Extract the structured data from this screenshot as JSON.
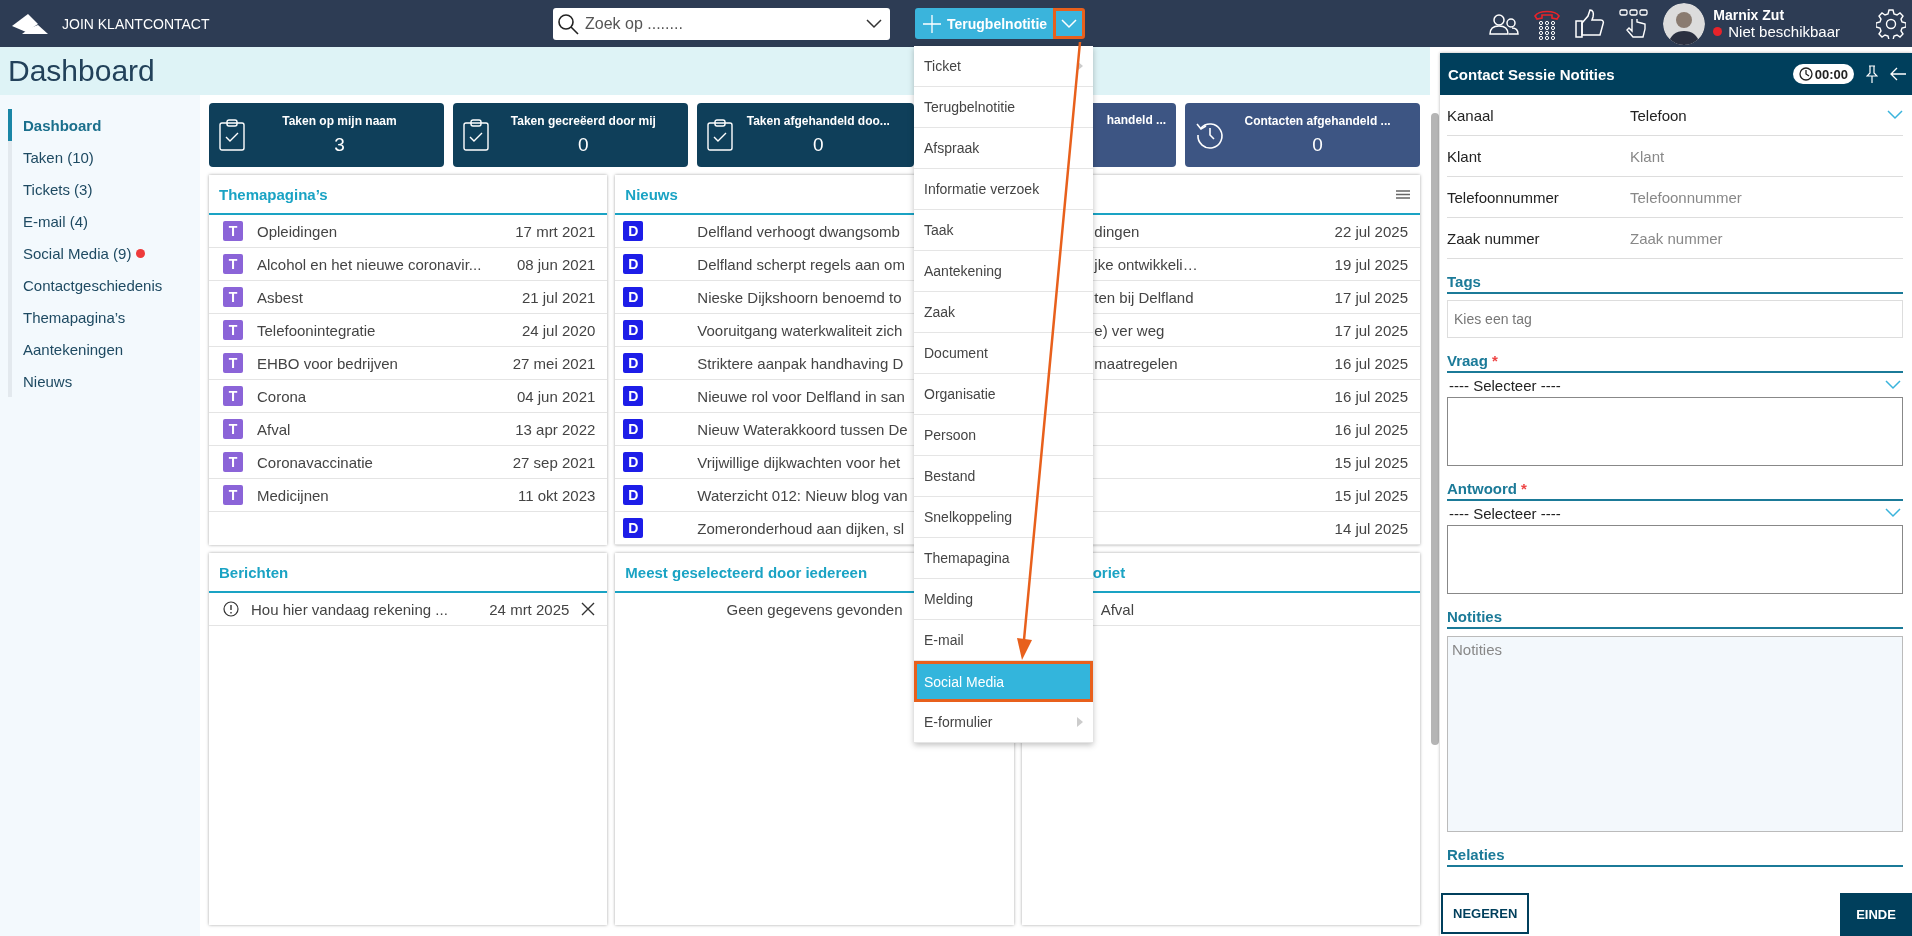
{
  "app": {
    "title": "JOIN KLANTCONTACT"
  },
  "search": {
    "placeholder": "Zoek op ........"
  },
  "new_button": {
    "label": "Terugbelnotitie",
    "expanded": true
  },
  "new_menu": [
    {
      "label": "Ticket",
      "submenu": true,
      "selected": false
    },
    {
      "label": "Terugbelnotitie",
      "submenu": false,
      "selected": false
    },
    {
      "label": "Afspraak",
      "submenu": false,
      "selected": false
    },
    {
      "label": "Informatie verzoek",
      "submenu": false,
      "selected": false
    },
    {
      "label": "Taak",
      "submenu": false,
      "selected": false
    },
    {
      "label": "Aantekening",
      "submenu": false,
      "selected": false
    },
    {
      "label": "Zaak",
      "submenu": false,
      "selected": false
    },
    {
      "label": "Document",
      "submenu": false,
      "selected": false
    },
    {
      "label": "Organisatie",
      "submenu": false,
      "selected": false
    },
    {
      "label": "Persoon",
      "submenu": false,
      "selected": false
    },
    {
      "label": "Bestand",
      "submenu": false,
      "selected": false
    },
    {
      "label": "Snelkoppeling",
      "submenu": false,
      "selected": false
    },
    {
      "label": "Themapagina",
      "submenu": false,
      "selected": false
    },
    {
      "label": "Melding",
      "submenu": false,
      "selected": false
    },
    {
      "label": "E-mail",
      "submenu": false,
      "selected": false
    },
    {
      "label": "Social Media",
      "submenu": false,
      "selected": true
    },
    {
      "label": "E-formulier",
      "submenu": true,
      "selected": false
    }
  ],
  "user": {
    "name": "Marnix Zut",
    "status": {
      "label": "Niet beschikbaar",
      "color": "#e8232a"
    }
  },
  "page_title": "Dashboard",
  "sidebar": [
    {
      "label": "Dashboard",
      "selected": true,
      "notification": false
    },
    {
      "label": "Taken (10)",
      "selected": false,
      "notification": false
    },
    {
      "label": "Tickets (3)",
      "selected": false,
      "notification": false
    },
    {
      "label": "E-mail (4)",
      "selected": false,
      "notification": false
    },
    {
      "label": "Social Media (9)",
      "selected": false,
      "notification": true
    },
    {
      "label": "Contactgeschiedenis",
      "selected": false,
      "notification": false
    },
    {
      "label": "Themapagina’s",
      "selected": false,
      "notification": false
    },
    {
      "label": "Aantekeningen",
      "selected": false,
      "notification": false
    },
    {
      "label": "Nieuws",
      "selected": false,
      "notification": false
    }
  ],
  "stat_cards": [
    {
      "kind": "task",
      "title": "Taken op mijn naam",
      "value": "3",
      "color": "#0f3f5a"
    },
    {
      "kind": "task",
      "title": "Taken gecreëerd door mij",
      "value": "0",
      "color": "#0f3f5a"
    },
    {
      "kind": "task",
      "title": "Taken afgehandeld doo...",
      "value": "0",
      "color": "#0f3f5a"
    },
    {
      "kind": "covered",
      "title": "handeld ...",
      "color": "#3d5583"
    },
    {
      "kind": "contact",
      "title": "Contacten afgehandeld ...",
      "value": "0",
      "color": "#3d5583"
    }
  ],
  "panels": [
    {
      "kind": "theme",
      "title": "Themapagina’s",
      "items": [
        {
          "badge": "T",
          "title": "Opleidingen",
          "date": "17 mrt 2021"
        },
        {
          "badge": "T",
          "title": "Alcohol en het nieuwe coronavir...",
          "date": "08 jun 2021"
        },
        {
          "badge": "T",
          "title": "Asbest",
          "date": "21 jul 2021"
        },
        {
          "badge": "T",
          "title": "Telefoonintegratie",
          "date": "24 jul 2020"
        },
        {
          "badge": "T",
          "title": "EHBO voor bedrijven",
          "date": "27 mei 2021"
        },
        {
          "badge": "T",
          "title": "Corona",
          "date": "04 jun 2021"
        },
        {
          "badge": "T",
          "title": "Afval",
          "date": "13 apr 2022"
        },
        {
          "badge": "T",
          "title": "Coronavaccinatie",
          "date": "27 sep 2021"
        },
        {
          "badge": "T",
          "title": "Medicijnen",
          "date": "11 okt 2023"
        }
      ]
    },
    {
      "kind": "news",
      "title": "Nieuws",
      "items": [
        {
          "badge": "D",
          "title": "Delfland verhoogt dwangsomb",
          "tail": "dingen",
          "date": "22 jul 2025"
        },
        {
          "badge": "D",
          "title": "Delfland scherpt regels aan om",
          "tail": "jke ontwikkeli…",
          "date": "19 jul 2025"
        },
        {
          "badge": "D",
          "title": "Nieske Dijkshoorn benoemd to",
          "tail": "ten bij Delfland",
          "date": "17 jul 2025"
        },
        {
          "badge": "D",
          "title": "Vooruitgang waterkwaliteit zich",
          "tail": "e) ver weg",
          "date": "17 jul 2025"
        },
        {
          "badge": "D",
          "title": "Striktere aanpak handhaving D",
          "tail": "maatregelen",
          "date": "16 jul 2025"
        },
        {
          "badge": "D",
          "title": "Nieuwe rol voor Delfland in san",
          "date": "16 jul 2025"
        },
        {
          "badge": "D",
          "title": "Nieuw Waterakkoord tussen De",
          "date": "16 jul 2025"
        },
        {
          "badge": "D",
          "title": "Vrijwillige dijkwachten voor het",
          "date": "15 jul 2025"
        },
        {
          "badge": "D",
          "title": "Waterzicht 012: Nieuw blog van",
          "date": "15 jul 2025"
        },
        {
          "badge": "D",
          "title": "Zomeronderhoud aan dijken, sl",
          "date": "14 jul 2025"
        }
      ]
    },
    {
      "kind": "messages",
      "title": "Berichten",
      "items": [
        {
          "title": "Hou hier vandaag rekening ...",
          "date": "24 mrt 2025"
        }
      ]
    },
    {
      "kind": "empty",
      "title": "Meest geselecteerd door iedereen",
      "empty_text": "Geen gegevens gevonden"
    },
    {
      "kind": "favorites",
      "title": "oriet",
      "items": [
        {
          "title": "Afval"
        }
      ]
    }
  ],
  "session": {
    "title": "Contact Sessie Notities",
    "timer": "00:00",
    "fields": [
      {
        "kind": "select",
        "label": "Kanaal",
        "value": "Telefoon"
      },
      {
        "kind": "text",
        "label": "Klant",
        "placeholder": "Klant"
      },
      {
        "kind": "text",
        "label": "Telefoonnummer",
        "placeholder": "Telefoonnummer"
      },
      {
        "kind": "text",
        "label": "Zaak nummer",
        "placeholder": "Zaak nummer"
      }
    ],
    "sections": [
      {
        "kind": "tags",
        "title": "Tags",
        "placeholder": "Kies een tag"
      },
      {
        "kind": "select_text",
        "title": "Vraag",
        "required_mark": "*",
        "value": "---- Selecteer ----"
      },
      {
        "kind": "select_text",
        "title": "Antwoord",
        "required_mark": "*",
        "value": "---- Selecteer ----"
      },
      {
        "kind": "notes",
        "title": "Notities",
        "placeholder": "Notities"
      },
      {
        "kind": "header",
        "title": "Relaties"
      }
    ],
    "buttons": [
      {
        "kind": "secondary",
        "label": "NEGEREN"
      },
      {
        "kind": "primary",
        "label": "EINDE"
      }
    ]
  }
}
